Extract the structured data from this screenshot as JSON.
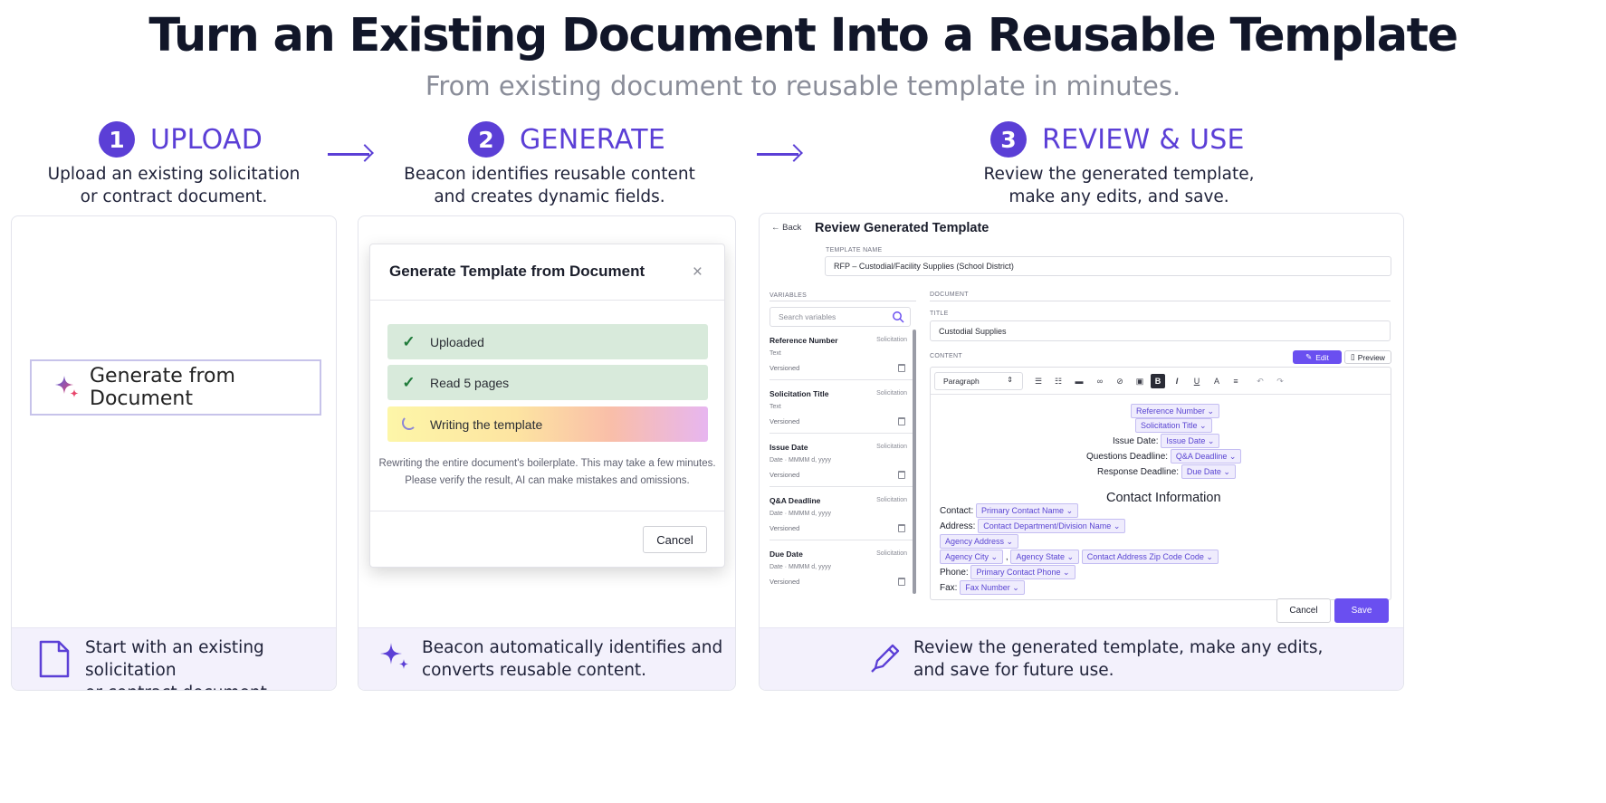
{
  "header": {
    "title": "Turn an Existing Document Into a Reusable Template",
    "subtitle": "From existing document to reusable template in minutes."
  },
  "steps": [
    {
      "number": "1",
      "label": "UPLOAD",
      "desc_line1": "Upload an existing solicitation",
      "desc_line2": "or contract document.",
      "footer_line1": "Start with an existing solicitation",
      "footer_line2": "or contract document."
    },
    {
      "number": "2",
      "label": "GENERATE",
      "desc_line1": "Beacon identifies reusable content",
      "desc_line2": "and creates dynamic fields.",
      "footer_line1": "Beacon automatically identifies and",
      "footer_line2": "converts reusable content."
    },
    {
      "number": "3",
      "label": "REVIEW & USE",
      "desc_line1": "Review the generated template,",
      "desc_line2": "make any edits, and save.",
      "footer_line1": "Review the generated template, make any edits,",
      "footer_line2": "and save for future use."
    }
  ],
  "upload_card": {
    "button_label": "Generate from Document",
    "icon": "sparkle-icon"
  },
  "modal": {
    "title": "Generate Template from Document",
    "close": "×",
    "progress": [
      {
        "label": "Uploaded",
        "state": "done"
      },
      {
        "label": "Read 5 pages",
        "state": "done"
      },
      {
        "label": "Writing the template",
        "state": "in-progress"
      }
    ],
    "note_line1": "Rewriting the entire document's boilerplate. This may take a few minutes.",
    "note_line2": "Please verify the result, AI can make mistakes and omissions.",
    "cancel": "Cancel"
  },
  "review": {
    "back": "Back",
    "title": "Review Generated Template",
    "template_name_label": "TEMPLATE NAME",
    "template_name_value": "RFP – Custodial/Facility Supplies (School District)",
    "variables_label": "VARIABLES",
    "search_placeholder": "Search variables",
    "variables": [
      {
        "name": "Reference Number",
        "source": "Solicitation",
        "type": "Text",
        "version": "Versioned"
      },
      {
        "name": "Solicitation Title",
        "source": "Solicitation",
        "type": "Text",
        "version": "Versioned"
      },
      {
        "name": "Issue Date",
        "source": "Solicitation",
        "type": "Date · MMMM d, yyyy",
        "version": "Versioned"
      },
      {
        "name": "Q&A Deadline",
        "source": "Solicitation",
        "type": "Date · MMMM d, yyyy",
        "version": "Versioned"
      },
      {
        "name": "Due Date",
        "source": "Solicitation",
        "type": "Date · MMMM d, yyyy",
        "version": "Versioned"
      }
    ],
    "document_label": "DOCUMENT",
    "title_label": "TITLE",
    "title_value": "Custodial Supplies",
    "content_label": "CONTENT",
    "edit": "Edit",
    "preview": "Preview",
    "paragraph": "Paragraph",
    "doc": {
      "reference_chip": "Reference Number",
      "solicitation_chip": "Solicitation Title",
      "issue_label": "Issue Date:",
      "issue_chip": "Issue Date",
      "questions_label": "Questions Deadline:",
      "qa_chip": "Q&A Deadline",
      "response_label": "Response Deadline:",
      "due_chip": "Due Date",
      "heading": "Contact Information",
      "contact_label": "Contact:",
      "contact_chip": "Primary Contact Name",
      "address_label": "Address:",
      "department_chip": "Contact Department/Division Name",
      "agency_address_chip": "Agency Address",
      "city_chip": "Agency City",
      "comma": ",",
      "state_chip": "Agency State",
      "zip_chip": "Contact Address Zip Code Code",
      "phone_label": "Phone:",
      "phone_chip": "Primary Contact Phone",
      "fax_label": "Fax:",
      "fax_chip": "Fax Number"
    },
    "cancel": "Cancel",
    "save": "Save"
  },
  "colors": {
    "accent": "#5b3fd6",
    "done": "#d8eadb",
    "footer_bg": "#f3f1fc",
    "save_button": "#6a4ff0"
  }
}
